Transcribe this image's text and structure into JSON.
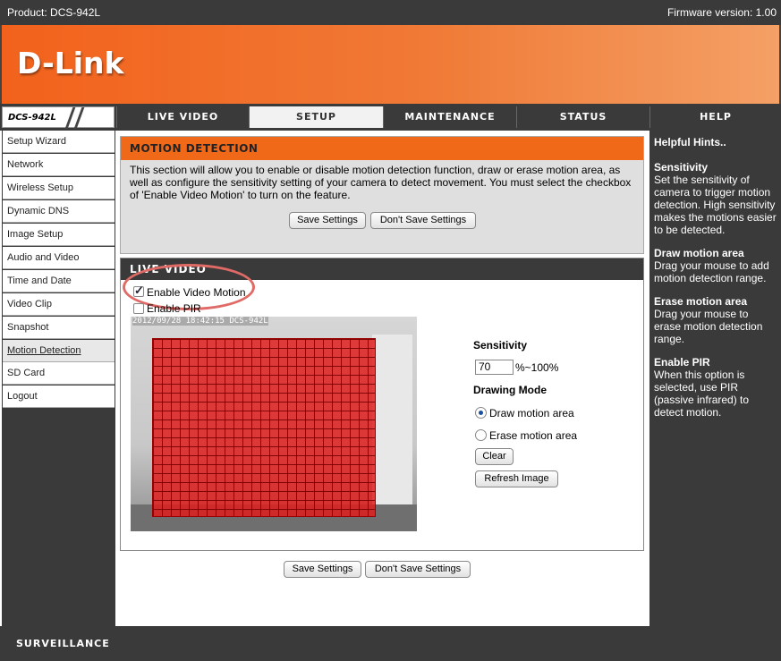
{
  "topbar": {
    "product": "Product: DCS-942L",
    "firmware": "Firmware version: 1.00"
  },
  "brand": {
    "logo": "D-Link",
    "model": "DCS-942L"
  },
  "nav": {
    "tabs": [
      {
        "label": "LIVE VIDEO",
        "active": false
      },
      {
        "label": "SETUP",
        "active": true
      },
      {
        "label": "MAINTENANCE",
        "active": false
      },
      {
        "label": "STATUS",
        "active": false
      },
      {
        "label": "HELP",
        "active": false
      }
    ]
  },
  "sidebar": {
    "items": [
      {
        "label": "Setup Wizard"
      },
      {
        "label": "Network"
      },
      {
        "label": "Wireless Setup"
      },
      {
        "label": "Dynamic DNS"
      },
      {
        "label": "Image Setup"
      },
      {
        "label": "Audio and Video"
      },
      {
        "label": "Time and Date"
      },
      {
        "label": "Video Clip"
      },
      {
        "label": "Snapshot"
      },
      {
        "label": "Motion Detection",
        "selected": true
      },
      {
        "label": "SD Card"
      },
      {
        "label": "Logout"
      }
    ]
  },
  "motion": {
    "title": "MOTION DETECTION",
    "description": "This section will allow you to enable or disable motion detection function, draw or erase motion area, as well as configure the sensitivity setting of your camera to detect movement. You must select the checkbox of 'Enable Video Motion' to turn on the feature.",
    "save": "Save Settings",
    "dont_save": "Don't Save Settings"
  },
  "live": {
    "title": "LIVE VIDEO",
    "enable_motion": "Enable Video Motion",
    "enable_motion_checked": true,
    "enable_pir": "Enable PIR",
    "enable_pir_checked": false,
    "timestamp": "2012/09/28 18:42:15 DCS-942L",
    "sensitivity_label": "Sensitivity",
    "sensitivity_value": "70",
    "sensitivity_range": "%~100%",
    "drawing_mode_label": "Drawing Mode",
    "draw_option": "Draw motion area",
    "erase_option": "Erase motion area",
    "selected_mode": "draw",
    "clear": "Clear",
    "refresh": "Refresh Image"
  },
  "bottom": {
    "save": "Save Settings",
    "dont_save": "Don't Save Settings"
  },
  "help": {
    "title": "Helpful Hints..",
    "hints": [
      {
        "title": "Sensitivity",
        "body": "Set the sensitivity of camera to trigger motion detection. High sensitivity makes the motions easier to be detected."
      },
      {
        "title": "Draw motion area",
        "body": "Drag your mouse to add motion detection range."
      },
      {
        "title": "Erase motion area",
        "body": "Drag your mouse to erase motion detection range."
      },
      {
        "title": "Enable PIR",
        "body": "When this option is selected, use PIR (passive infrared) to detect motion."
      }
    ]
  },
  "footer": {
    "text": "SURVEILLANCE"
  },
  "colors": {
    "accent": "#f06918",
    "dark": "#3a3a3a",
    "motion_grid": "#e11e1e"
  }
}
